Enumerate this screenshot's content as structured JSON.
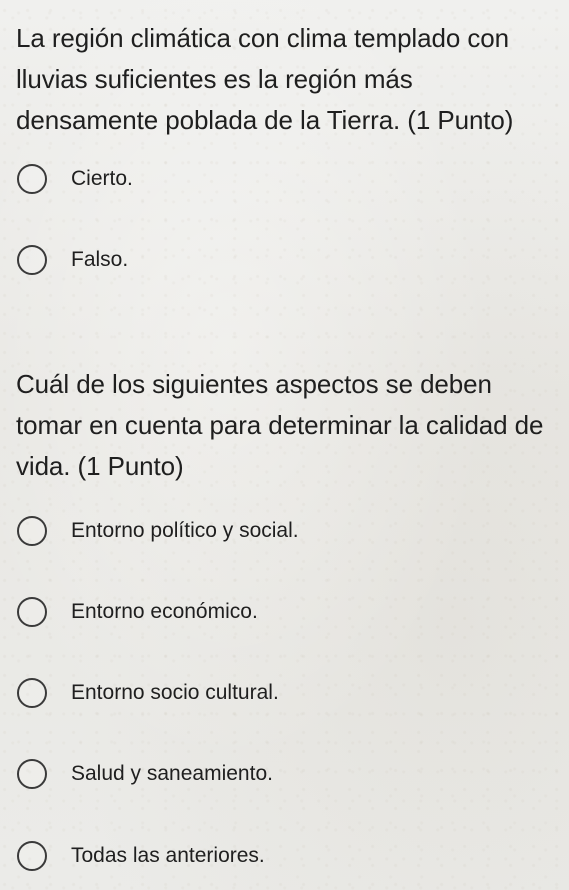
{
  "questions": [
    {
      "text": "La región climática con clima templado con lluvias suficientes es la región más densamente poblada de la Tierra. (1 Punto)",
      "options": [
        "Cierto.",
        "Falso."
      ]
    },
    {
      "text": "Cuál de los siguientes aspectos se deben tomar en cuenta para determinar la calidad de vida. (1 Punto)",
      "options": [
        "Entorno político y social.",
        "Entorno económico.",
        "Entorno socio cultural.",
        "Salud y saneamiento.",
        "Todas las anteriores."
      ]
    }
  ]
}
